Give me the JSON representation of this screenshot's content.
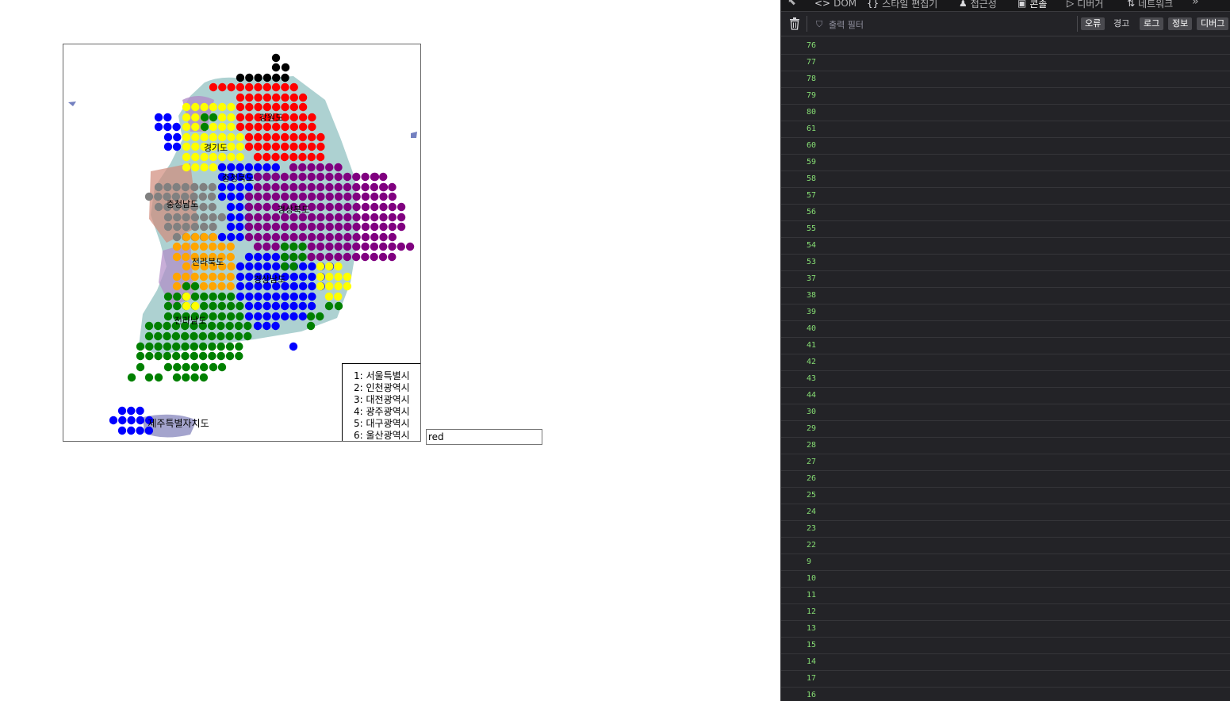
{
  "map": {
    "region_labels": [
      "강원도",
      "경기도",
      "충청북도",
      "충청남도",
      "경상북도",
      "전라북도",
      "경상남도",
      "전라남도",
      "제주특별자치도"
    ],
    "legend": [
      "1: 서울특별시",
      "2: 인천광역시",
      "3: 대전광역시",
      "4: 광주광역시",
      "5: 대구광역시",
      "6: 울산광역시"
    ],
    "colors": {
      "red": "#ff0000",
      "black": "#000000",
      "yellow": "#ffff00",
      "green": "#008000",
      "blue": "#0000ff",
      "purple": "#800080",
      "gray": "#808080",
      "orange": "#ffa500",
      "map_teal": "#6aacac",
      "map_lavender": "#b08cc8",
      "map_salmon": "#d08a7a",
      "map_slate": "#9a9ac8",
      "map_lightblue": "#8fb8d8",
      "map_darkblue": "#5060b0"
    }
  },
  "color_input": {
    "value": "red"
  },
  "devtools": {
    "tabs": [
      {
        "label": "DOM",
        "icon": "code-brackets-icon"
      },
      {
        "label": "스타일 편집기",
        "icon": "braces-icon"
      },
      {
        "label": "접근성",
        "icon": "accessibility-icon"
      },
      {
        "label": "콘솔",
        "icon": "console-icon"
      },
      {
        "label": "디버거",
        "icon": "debugger-icon"
      },
      {
        "label": "네트워크",
        "icon": "network-icon"
      }
    ],
    "filter_placeholder": "출력 필터",
    "levels": [
      {
        "label": "오류",
        "active": true
      },
      {
        "label": "경고",
        "active": false
      },
      {
        "label": "로그",
        "active": true
      },
      {
        "label": "정보",
        "active": true
      },
      {
        "label": "디버그",
        "active": true
      }
    ],
    "console_lines": [
      "76",
      "77",
      "78",
      "79",
      "80",
      "61",
      "60",
      "59",
      "58",
      "57",
      "56",
      "55",
      "54",
      "53",
      "37",
      "38",
      "39",
      "40",
      "41",
      "42",
      "43",
      "44",
      "30",
      "29",
      "28",
      "27",
      "26",
      "25",
      "24",
      "23",
      "22",
      "9",
      "10",
      "11",
      "12",
      "13",
      "15",
      "14",
      "17",
      "16"
    ]
  }
}
